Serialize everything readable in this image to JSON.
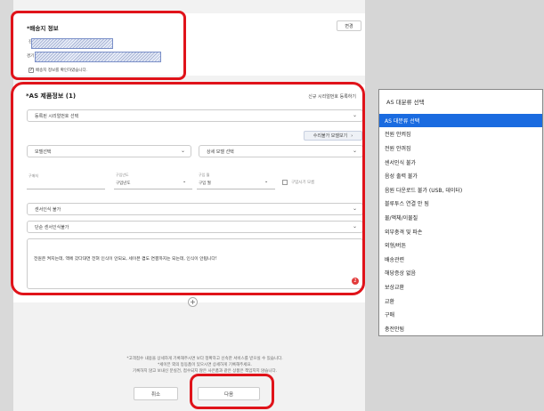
{
  "shipping": {
    "title": "*배송지 정보",
    "change_button": "변경",
    "name_label": "김",
    "address_label": "경기",
    "confirm_text": "배송지 정보를 확인하였습니다."
  },
  "product": {
    "title": "*AS 제품정보 (1)",
    "register_serial_link": "신규 시리얼번호 등록하기",
    "serial_select": "등록된 시리얼번호 선택",
    "fee_link": "수리불가 모델보기",
    "model_select": "모델선택",
    "detail_model_select": "상세 모델 선택",
    "store_label": "구매처",
    "year_label": "구입년도",
    "year_value": "구입년도",
    "month_label": "구입 월",
    "month_value": "구입 월",
    "unknown_date": "구입시기 모름",
    "category_select": "센서인식 불가",
    "sub_category_select": "단순 센서인식불가",
    "description": "전원은 켜지는데, 액에 갔다대면 전혀 인식이 안되요, 세이븐 켬도 연결까지는 되는데, 인식이 안됩니다!",
    "description_error_badge": "2",
    "add_icon": "plus-icon"
  },
  "notice": {
    "line1": "*고객접수 내용을 상세하게 기록해주시면 보다 정확하고 신속한 서비스를 받으실 수 있습니다.",
    "line2": "*세이븐 외의 등동품이 있으시면 상세하게 기록해주세요.",
    "line3": "기록하지 않고 보내신 분실건, 접수되지 않은 사은품과 같은 상품은 책임지지 않습니다."
  },
  "buttons": {
    "cancel": "취소",
    "next": "다음"
  },
  "dropdown": {
    "header": "AS 대분류 선택",
    "items": [
      "AS 대분류 선택",
      "전원 안켜짐",
      "전원 안꺼짐",
      "센서인식 불가",
      "음성 출력 불가",
      "음원 다운로드 불가 (USB, 데이터)",
      "블루투스 연결 안 됨",
      "물/액체/이물질",
      "외부충격 및 파손",
      "외형/버튼",
      "배송관련",
      "해당증상 없음",
      "보상교환",
      "교환",
      "구매",
      "충전안됨"
    ],
    "selected_index": 0
  },
  "colors": {
    "highlight": "#e0131a",
    "selected": "#1a6be0"
  }
}
